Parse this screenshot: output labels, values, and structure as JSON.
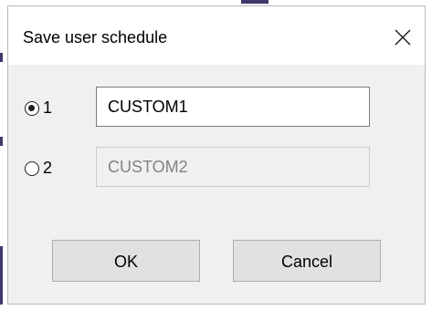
{
  "dialog": {
    "title": "Save user schedule",
    "close_icon": "close-icon"
  },
  "options": [
    {
      "label": "1",
      "selected": true,
      "value": "CUSTOM1",
      "enabled": true
    },
    {
      "label": "2",
      "selected": false,
      "value": "CUSTOM2",
      "enabled": false
    }
  ],
  "buttons": {
    "ok_label": "OK",
    "cancel_label": "Cancel"
  }
}
